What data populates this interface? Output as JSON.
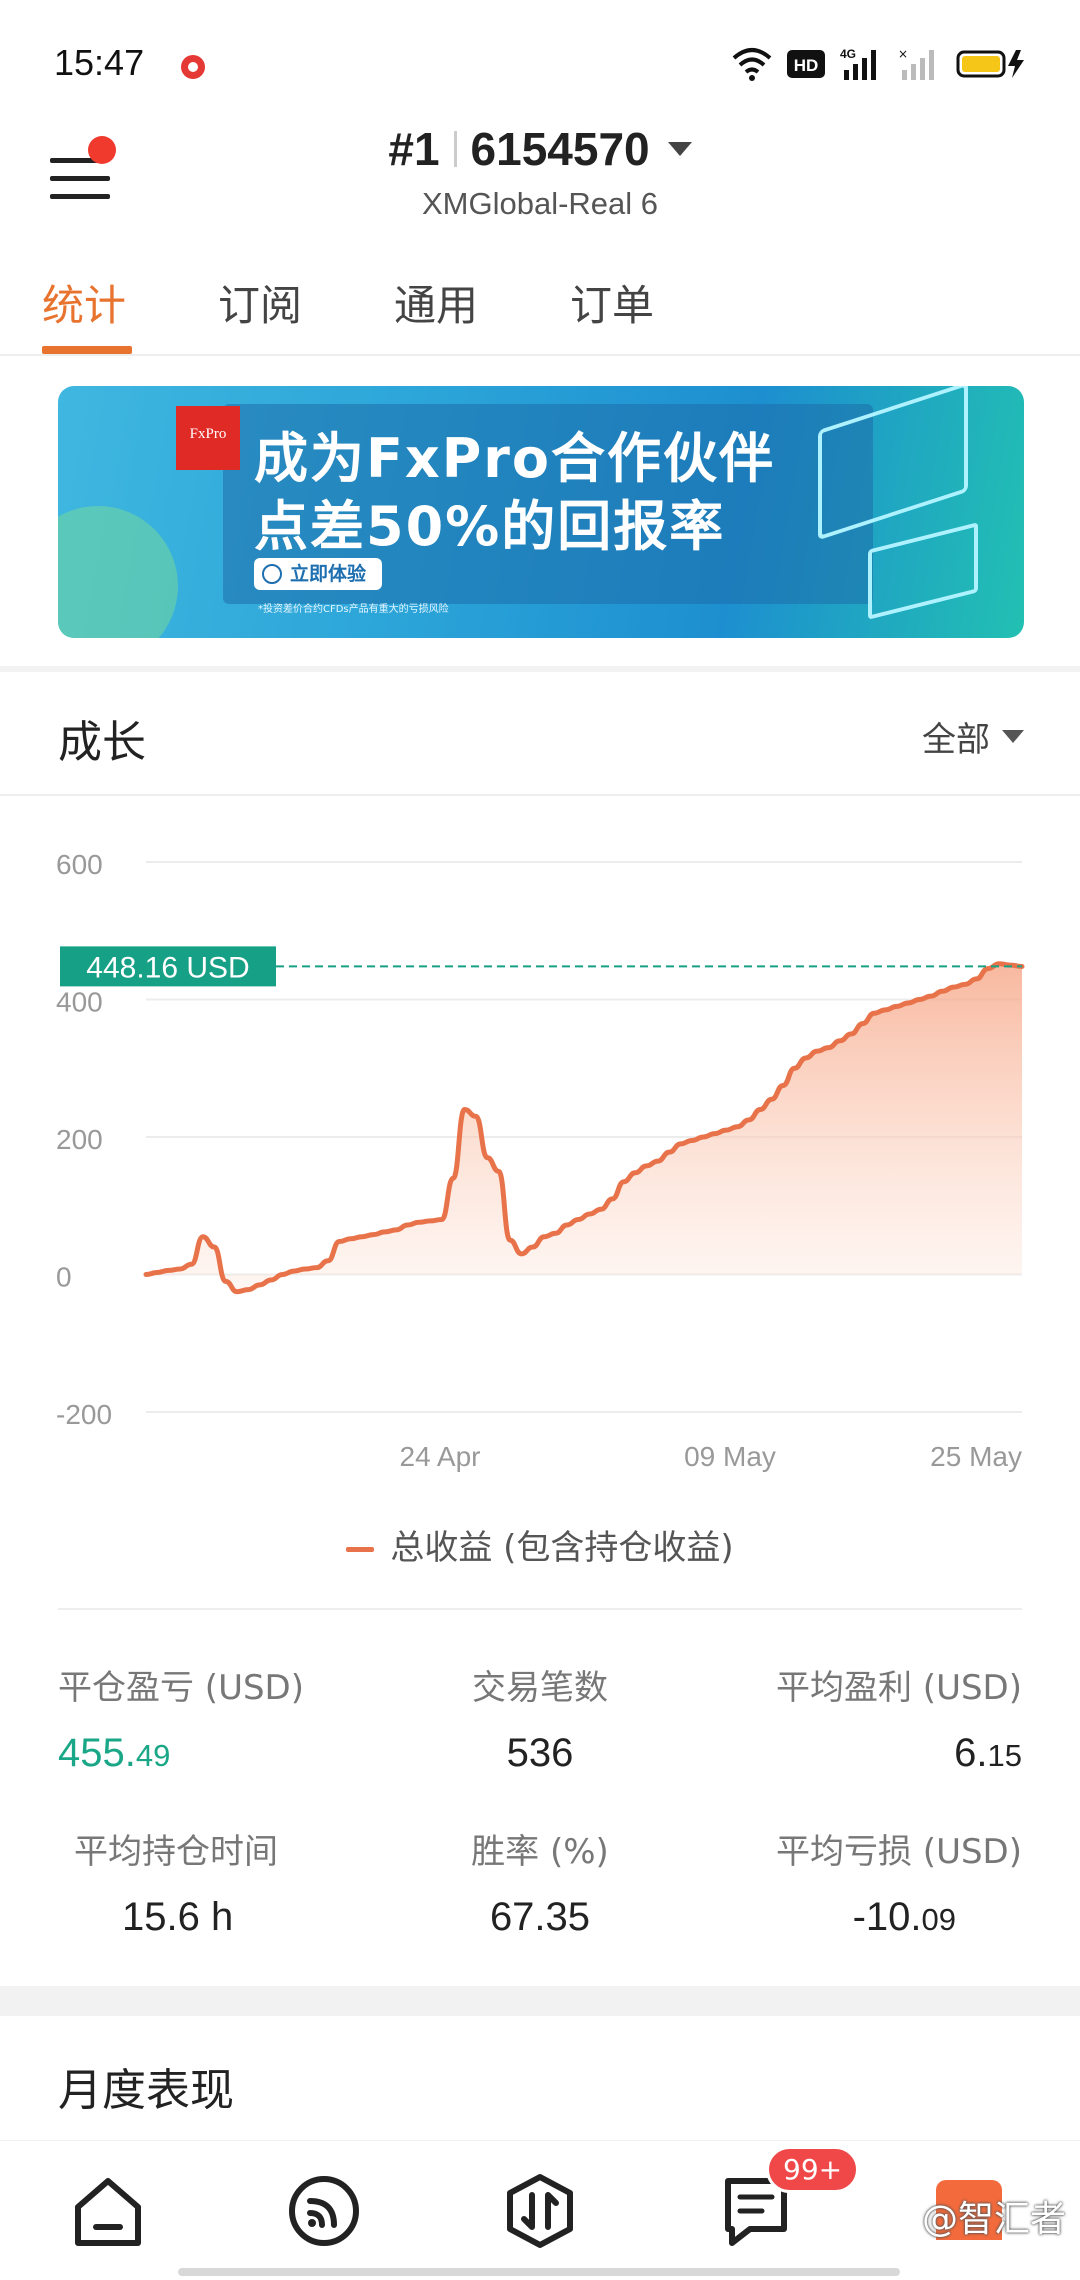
{
  "status_bar": {
    "time": "15:47",
    "network": "4G"
  },
  "header": {
    "account_index": "#1",
    "account_number": "6154570",
    "server": "XMGlobal-Real 6"
  },
  "tabs": [
    {
      "label": "统计",
      "active": true
    },
    {
      "label": "订阅",
      "active": false
    },
    {
      "label": "通用",
      "active": false
    },
    {
      "label": "订单",
      "active": false
    }
  ],
  "banner": {
    "logo": "FxPro",
    "line1": "成为FxPro合作伙伴",
    "line2": "点差50%的回报率",
    "cta": "立即体验",
    "fine_print": "*投资差价合约CFDs产品有重大的亏损风险"
  },
  "growth": {
    "title": "成长",
    "filter": "全部"
  },
  "chart_data": {
    "type": "area",
    "current_label": "448.16 USD",
    "current_value": 448.16,
    "ylim": [
      -200,
      600
    ],
    "y_ticks": [
      "600",
      "400",
      "200",
      "0",
      "-200"
    ],
    "x_tick_labels": [
      "24 Apr",
      "09 May",
      "25 May"
    ],
    "series": [
      {
        "name": "总收益 (包含持仓收益)",
        "color": "#e8734a",
        "values": [
          0,
          3,
          6,
          8,
          15,
          55,
          40,
          -10,
          -25,
          -22,
          -15,
          -8,
          0,
          5,
          8,
          10,
          20,
          48,
          52,
          55,
          58,
          62,
          65,
          72,
          76,
          78,
          80,
          140,
          240,
          230,
          170,
          150,
          50,
          30,
          40,
          55,
          60,
          72,
          80,
          88,
          95,
          110,
          135,
          148,
          158,
          165,
          178,
          190,
          195,
          200,
          205,
          210,
          215,
          225,
          240,
          255,
          275,
          300,
          315,
          325,
          330,
          340,
          350,
          365,
          380,
          385,
          390,
          395,
          400,
          405,
          412,
          418,
          422,
          430,
          445,
          452,
          450,
          448
        ]
      }
    ]
  },
  "legend": {
    "label": "总收益 (包含持仓收益)"
  },
  "stats": {
    "closed_pl": {
      "label": "平仓盈亏 (USD)",
      "int": "455.",
      "dec": "49"
    },
    "trades": {
      "label": "交易笔数",
      "value": "536"
    },
    "avg_profit": {
      "label": "平均盈利 (USD)",
      "int": "6.",
      "dec": "15"
    },
    "avg_hold": {
      "label": "平均持仓时间",
      "value": "15.6 h"
    },
    "win_rate": {
      "label": "胜率 (%)",
      "value": "67.35"
    },
    "avg_loss": {
      "label": "平均亏损 (USD)",
      "int": "-10.",
      "dec": "09"
    }
  },
  "monthly": {
    "title": "月度表现"
  },
  "bottom_nav": {
    "badge": "99+"
  },
  "watermark": "@智汇者",
  "colors": {
    "accent": "#e8732f",
    "positive": "#1aa787",
    "series": "#e8734a"
  }
}
